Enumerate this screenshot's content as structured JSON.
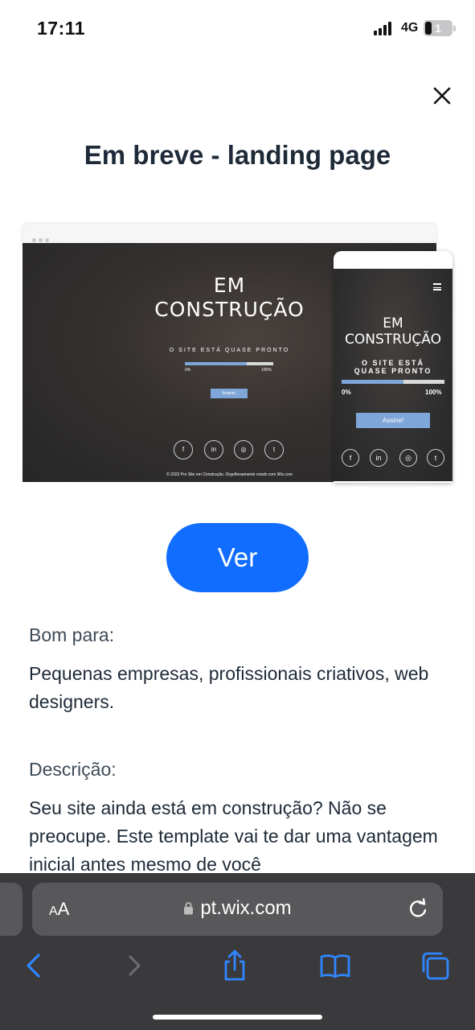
{
  "status_bar": {
    "time": "17:11",
    "network": "4G",
    "battery": "1"
  },
  "dialog": {
    "title": "Em breve - landing page"
  },
  "preview": {
    "heading_line1": "EM",
    "heading_line2": "CONSTRUÇÃO",
    "subtitle": "O SITE ESTÁ QUASE PRONTO",
    "mobile_subtitle_line1": "O SITE ESTÁ",
    "mobile_subtitle_line2": "QUASE PRONTO",
    "progress_start": "0%",
    "progress_end": "100%",
    "progress_fraction": 0.7,
    "mobile_progress_fraction": 0.6,
    "button": "Assine!",
    "social": [
      "f",
      "in",
      "◎",
      "t"
    ],
    "footer": "© 2023 Por Site em Construção. Orgulhosamente criado com Wix.com"
  },
  "view_button": "Ver",
  "good_for": {
    "label": "Bom para:",
    "text": "Pequenas empresas, profissionais criativos, web designers."
  },
  "description": {
    "label": "Descrição:",
    "text": "Seu site ainda está em construção? Não se preocupe. Este template vai te dar uma vantagem inicial antes mesmo de você"
  },
  "browser": {
    "text_size_small": "A",
    "text_size_large": "A",
    "url": "pt.wix.com"
  },
  "colors": {
    "accent": "#116dff",
    "toolbar_icon": "#2f86ff",
    "toolbar_bg": "#3a3a3c"
  }
}
